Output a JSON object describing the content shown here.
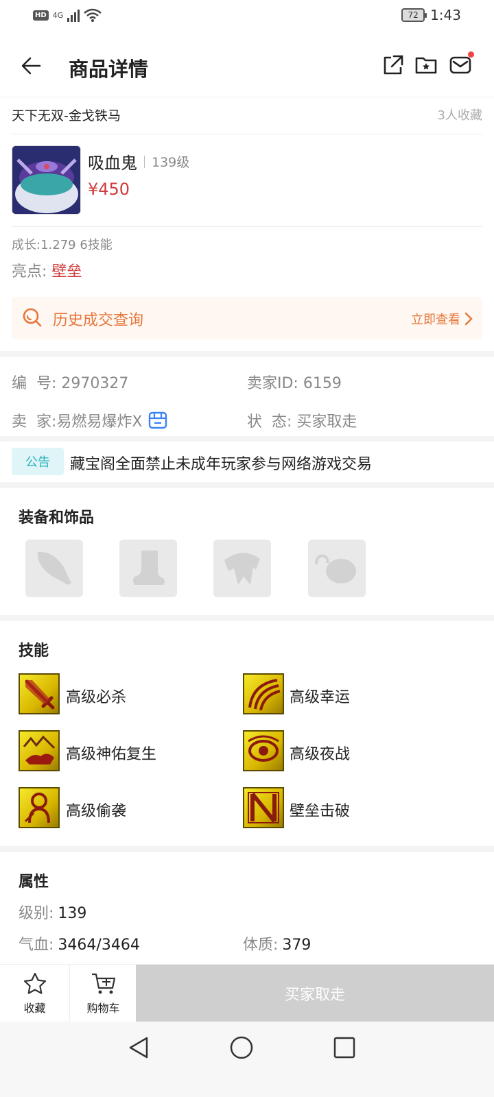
{
  "status_bar": {
    "hd": "HD",
    "network": "4G",
    "battery": "72",
    "time": "1:43"
  },
  "header": {
    "title": "商品详情",
    "icons": [
      "back-icon",
      "share-icon",
      "folder-star-icon",
      "mail-icon"
    ]
  },
  "product": {
    "name_line": "天下无双-金戈铁马",
    "favorites": "3人收藏",
    "pet_name": "吸血鬼",
    "level": "139级",
    "price": "¥450",
    "growth": "成长:1.279 6技能",
    "highlight_label": "亮点:",
    "highlight_value": "壁垒"
  },
  "history": {
    "label": "历史成交查询",
    "action": "立即查看"
  },
  "info": {
    "id_label": "编  号:",
    "id_value": "2970327",
    "seller_id_label": "卖家ID:",
    "seller_id_value": "6159",
    "seller_label": "卖  家:",
    "seller_value": "易燃易爆炸X",
    "status_label": "状  态:",
    "status_value": "买家取走"
  },
  "notice": {
    "badge": "公告",
    "text": "藏宝阁全面禁止未成年玩家参与网络游戏交易"
  },
  "equipment": {
    "title": "装备和饰品",
    "slots": [
      "weapon-slot-icon",
      "boot-slot-icon",
      "armor-slot-icon",
      "accessory-slot-icon"
    ]
  },
  "skills": {
    "title": "技能",
    "items": [
      {
        "label": "高级必杀",
        "icon": "sword-skill-icon"
      },
      {
        "label": "高级幸运",
        "icon": "luck-skill-icon"
      },
      {
        "label": "高级神佑复生",
        "icon": "revive-skill-icon"
      },
      {
        "label": "高级夜战",
        "icon": "night-skill-icon"
      },
      {
        "label": "高级偷袭",
        "icon": "sneak-skill-icon"
      },
      {
        "label": "壁垒击破",
        "icon": "barrier-skill-icon"
      }
    ]
  },
  "attributes": {
    "title": "属性",
    "level_label": "级别:",
    "level_value": "139",
    "hp_label": "气血:",
    "hp_value": "3464/3464",
    "con_label": "体质:",
    "con_value": "379"
  },
  "bottom_bar": {
    "favorite": "收藏",
    "cart": "购物车",
    "buy": "买家取走"
  },
  "colors": {
    "price": "#d03a3a",
    "accent_orange": "#e5763a",
    "notice_teal": "#2bb3bf",
    "disabled": "#cfcfcf"
  }
}
